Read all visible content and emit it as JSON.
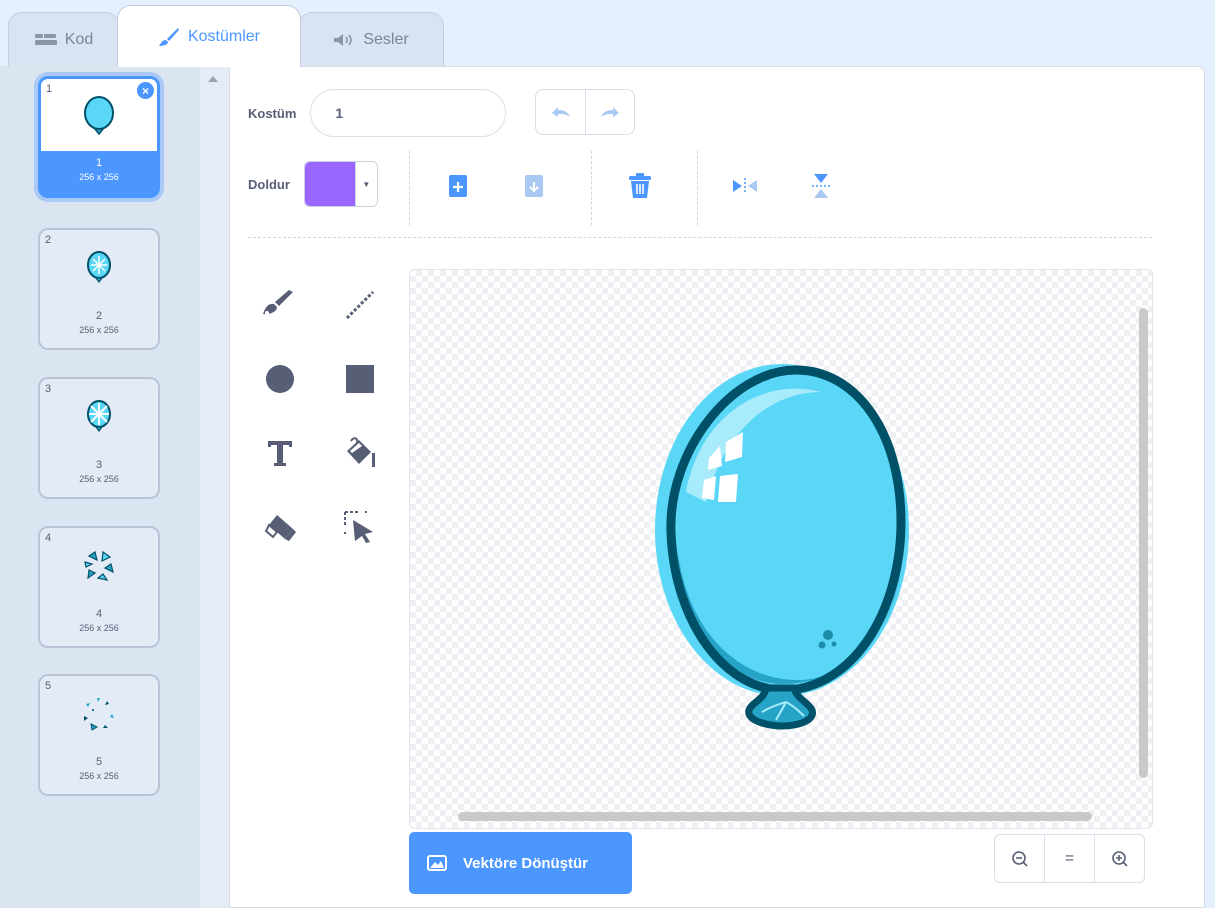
{
  "tabs": [
    {
      "label": "Kod",
      "icon": "code-icon"
    },
    {
      "label": "Kostümler",
      "icon": "paintbrush-icon"
    },
    {
      "label": "Sesler",
      "icon": "speaker-icon"
    }
  ],
  "costumes": [
    {
      "number": "1",
      "name": "1",
      "size": "256 x 256",
      "selected": true
    },
    {
      "number": "2",
      "name": "2",
      "size": "256 x 256"
    },
    {
      "number": "3",
      "name": "3",
      "size": "256 x 256"
    },
    {
      "number": "4",
      "name": "4",
      "size": "256 x 256"
    },
    {
      "number": "5",
      "name": "5",
      "size": "256 x 256"
    }
  ],
  "editor": {
    "costume_label": "Kostüm",
    "costume_name": "1",
    "fill_label": "Doldur",
    "fill_color": "#9966ff",
    "convert_button": "Vektöre Dönüştür",
    "zoom": {
      "out": "zoom-out-icon",
      "reset": "=",
      "in": "zoom-in-icon"
    }
  },
  "colors": {
    "accent": "#4c97ff",
    "balloon_fill": "#5ad7f7",
    "balloon_outline": "#005067",
    "icon_gray": "#575e75"
  }
}
